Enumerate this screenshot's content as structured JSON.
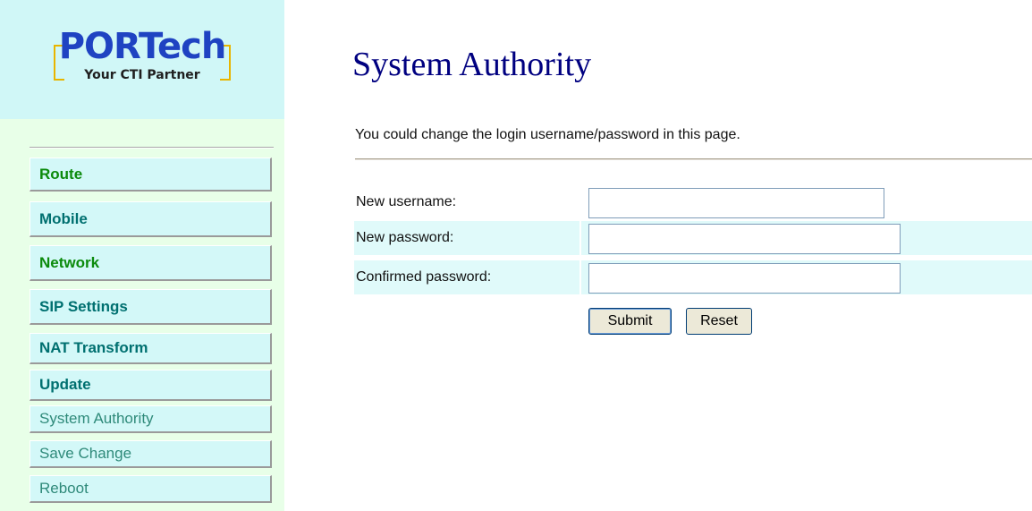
{
  "logo": {
    "brand": "PORTech",
    "tagline": "Your CTI Partner"
  },
  "sidebar": {
    "items": [
      {
        "label": "Route"
      },
      {
        "label": "Mobile"
      },
      {
        "label": "Network"
      },
      {
        "label": "SIP Settings"
      },
      {
        "label": "NAT Transform"
      },
      {
        "label": "Update"
      },
      {
        "label": "System Authority"
      },
      {
        "label": "Save Change"
      },
      {
        "label": "Reboot"
      }
    ]
  },
  "main": {
    "title": "System Authority",
    "description": "You could change the login username/password in this page.",
    "form": {
      "username_label": "New username:",
      "username_value": "",
      "password_label": "New password:",
      "password_value": "",
      "confirm_label": "Confirmed password:",
      "confirm_value": ""
    },
    "buttons": {
      "submit": "Submit",
      "reset": "Reset"
    }
  },
  "colors": {
    "title": "#000080",
    "nav_bold": "#0b8a0b",
    "nav_plain": "#2f8a7a",
    "logo_brand": "#1f43c2",
    "logo_bracket": "#e8b500"
  }
}
